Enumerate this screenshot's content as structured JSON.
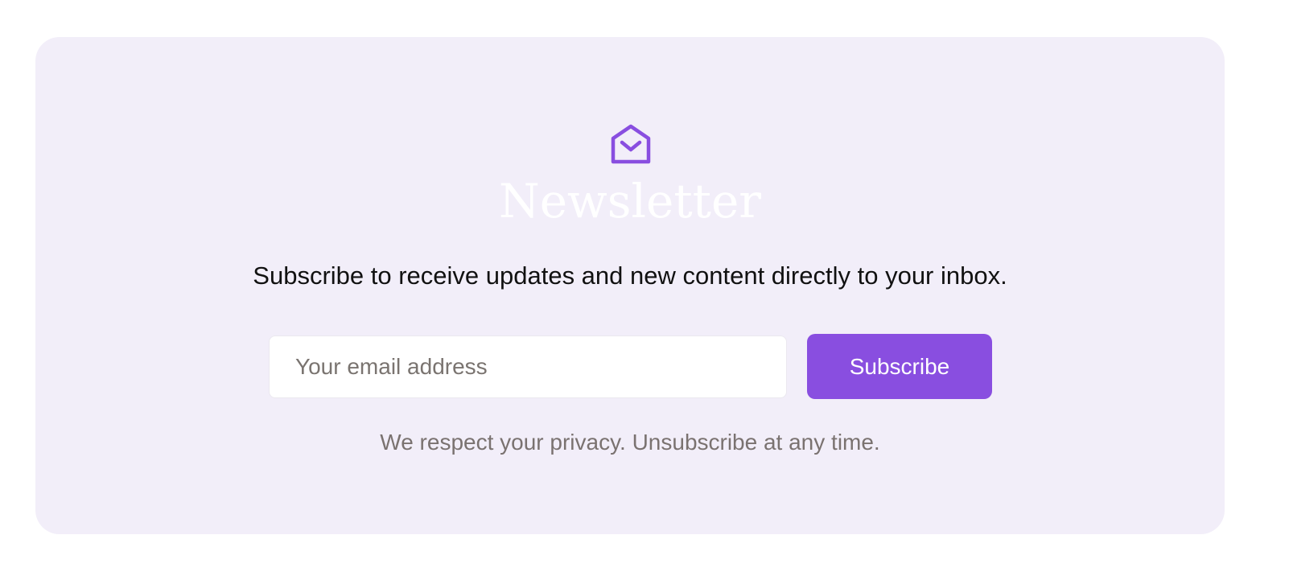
{
  "newsletter": {
    "icon": "open-envelope-icon",
    "title": "Newsletter",
    "description": "Subscribe to receive updates and new content directly to your inbox.",
    "email_placeholder": "Your email address",
    "email_value": "",
    "subscribe_label": "Subscribe",
    "privacy_note": "We respect your privacy. Unsubscribe at any time."
  },
  "colors": {
    "card_background": "#f2eef9",
    "accent": "#894ee0",
    "title": "#ffffff",
    "description": "#111111",
    "muted_text": "#7a7270"
  }
}
